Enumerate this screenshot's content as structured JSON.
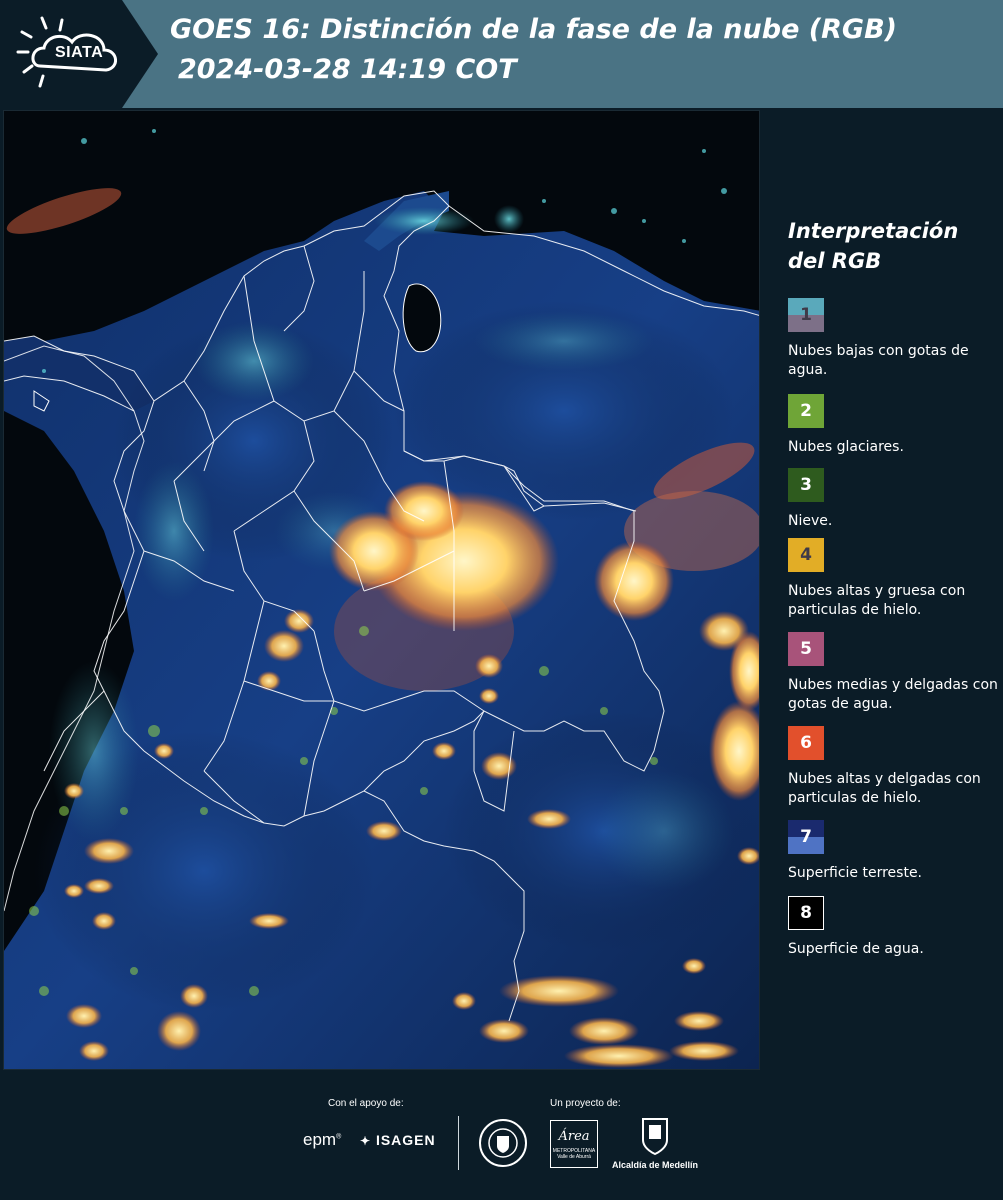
{
  "header": {
    "logo_text": "SIATA",
    "title_line1": "GOES 16: Distinción de la fase de la nube (RGB)",
    "title_line2": "2024-03-28 14:19 COT"
  },
  "legend": {
    "title_line1": "Interpretación",
    "title_line2": "del RGB",
    "items": [
      {
        "num": "1",
        "label": "Nubes bajas con gotas de agua.",
        "color_top": "#5aa9bb",
        "color_bottom": "#7d7088",
        "num_color": "#3f3a48"
      },
      {
        "num": "2",
        "label": "Nubes glaciares.",
        "color_top": "#6fa537",
        "color_bottom": "#6fa537",
        "num_color": "#ffffff"
      },
      {
        "num": "3",
        "label": "Nieve.",
        "color_top": "#2e5b1e",
        "color_bottom": "#2e5b1e",
        "num_color": "#ffffff"
      },
      {
        "num": "4",
        "label": "Nubes altas y gruesa con particulas de hielo.",
        "color_top": "#e2ad26",
        "color_bottom": "#e2ad26",
        "num_color": "#3f3a48"
      },
      {
        "num": "5",
        "label": "Nubes medias y delgadas con gotas de agua.",
        "color_top": "#a8537a",
        "color_bottom": "#a8537a",
        "num_color": "#ffffff"
      },
      {
        "num": "6",
        "label": "Nubes altas y delgadas con particulas de hielo.",
        "color_top": "#e2502c",
        "color_bottom": "#e2502c",
        "num_color": "#ffffff"
      },
      {
        "num": "7",
        "label": "Superficie terreste.",
        "color_top": "#1a2a6e",
        "color_bottom": "#4f73c4",
        "num_color": "#ffffff"
      },
      {
        "num": "8",
        "label": "Superficie de agua.",
        "color_top": "#000000",
        "color_bottom": "#000000",
        "num_color": "#ffffff"
      }
    ]
  },
  "footer": {
    "support_label": "Con el apoyo de:",
    "project_label": "Un proyecto de:",
    "sponsor_epm": "epm",
    "sponsor_isagen": "ISAGEN",
    "sponsor_area_line1": "Área",
    "sponsor_area_line2": "METROPOLITANA",
    "sponsor_area_line3": "Valle de Aburrá",
    "sponsor_alcaldia": "Alcaldía de Medellín"
  }
}
